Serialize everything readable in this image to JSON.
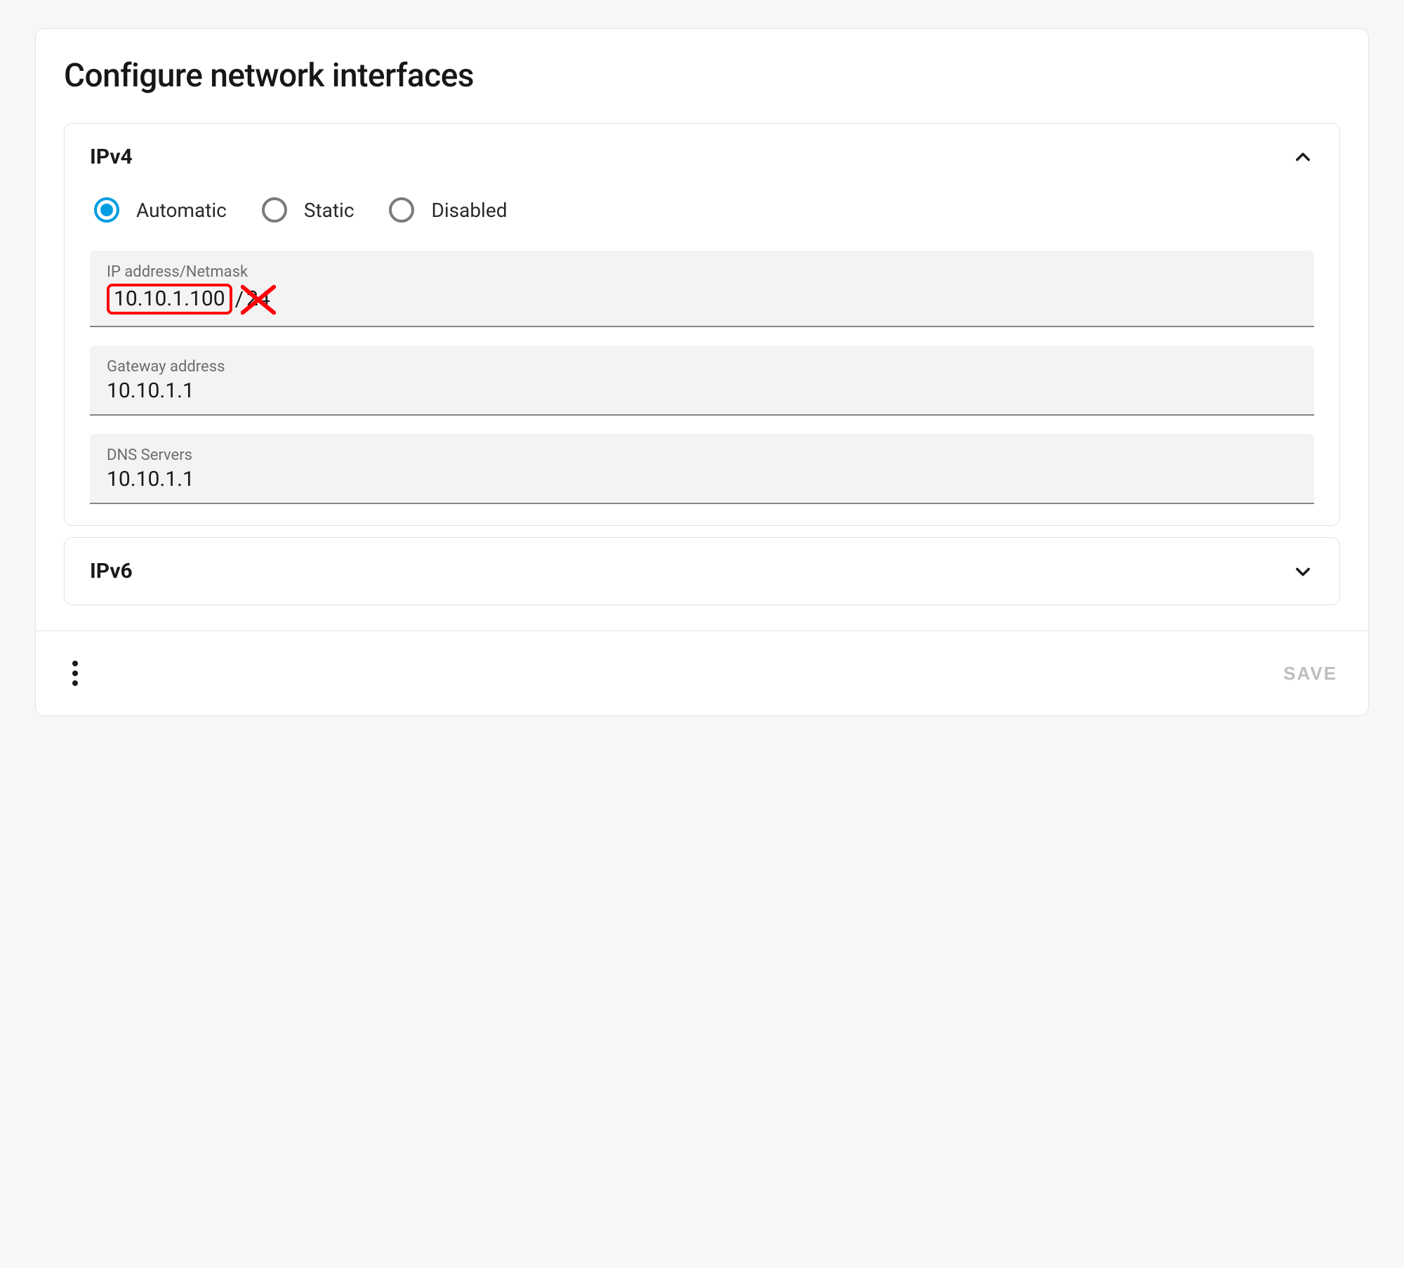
{
  "header": {
    "title": "Configure network interfaces"
  },
  "ipv4": {
    "title": "IPv4",
    "expanded": true,
    "radios": {
      "automatic": "Automatic",
      "static": "Static",
      "disabled": "Disabled",
      "selected": "automatic"
    },
    "fields": {
      "ip": {
        "label": "IP address/Netmask",
        "highlighted_value": "10.10.1.100",
        "slash": "/",
        "crossed_suffix": "24",
        "full_value": "10.10.1.100/24"
      },
      "gateway": {
        "label": "Gateway address",
        "value": "10.10.1.1"
      },
      "dns": {
        "label": "DNS Servers",
        "value": "10.10.1.1"
      }
    }
  },
  "ipv6": {
    "title": "IPv6",
    "expanded": false
  },
  "actions": {
    "save_label": "SAVE"
  },
  "annotation": {
    "highlight_color": "#ff0008"
  }
}
